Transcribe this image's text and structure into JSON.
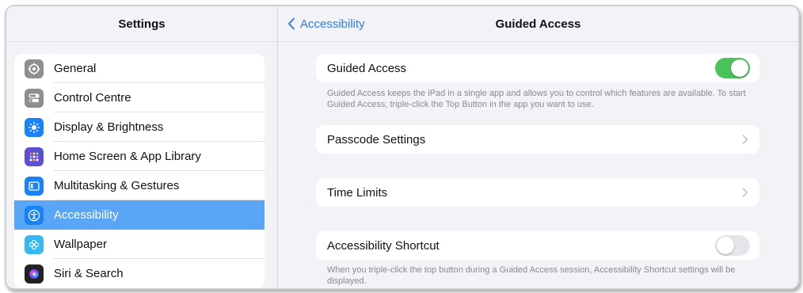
{
  "sidebar": {
    "title": "Settings",
    "items": [
      {
        "label": "General",
        "icon": "gear-icon",
        "color": "#8e8e93"
      },
      {
        "label": "Control Centre",
        "icon": "toggles-icon",
        "color": "#8e8e93"
      },
      {
        "label": "Display & Brightness",
        "icon": "sun-icon",
        "color": "#1a82f7"
      },
      {
        "label": "Home Screen & App Library",
        "icon": "grid-icon",
        "color": "#5b4fd6"
      },
      {
        "label": "Multitasking & Gestures",
        "icon": "multitask-icon",
        "color": "#1a82f7"
      },
      {
        "label": "Accessibility",
        "icon": "accessibility-icon",
        "color": "#1a82f7",
        "selected": true
      },
      {
        "label": "Wallpaper",
        "icon": "flower-icon",
        "color": "#36b8f0"
      },
      {
        "label": "Siri & Search",
        "icon": "siri-icon",
        "color": "#222222"
      }
    ]
  },
  "main": {
    "back_label": "Accessibility",
    "title": "Guided Access",
    "guided_access": {
      "label": "Guided Access",
      "enabled": true
    },
    "guided_access_footer": "Guided Access keeps the iPad in a single app and allows you to control which features are available. To start Guided Access, triple-click the Top Button in the app you want to use.",
    "passcode_settings": {
      "label": "Passcode Settings"
    },
    "time_limits": {
      "label": "Time Limits"
    },
    "accessibility_shortcut": {
      "label": "Accessibility Shortcut",
      "enabled": false
    },
    "accessibility_shortcut_footer": "When you triple-click the top button during a Guided Access session, Accessibility Shortcut settings will be displayed."
  },
  "colors": {
    "accent": "#2a7ee6",
    "selection": "#58a6f5",
    "toggle_on": "#4cc35a",
    "toggle_off": "#e6e6ea"
  }
}
